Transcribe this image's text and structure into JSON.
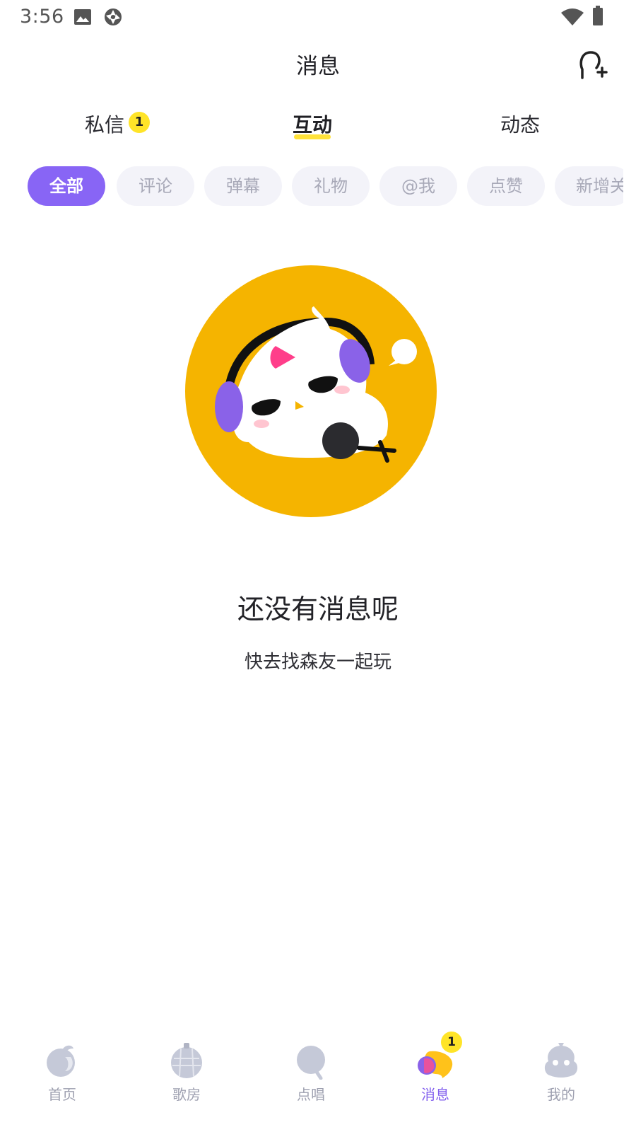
{
  "status_bar": {
    "time": "3:56",
    "icons": [
      "image-icon",
      "sync-icon",
      "wifi-icon",
      "battery-icon"
    ]
  },
  "header": {
    "title": "消息",
    "add_friend_icon": "add-friend-icon"
  },
  "main_tabs": [
    {
      "label": "私信",
      "badge": "1",
      "active": false
    },
    {
      "label": "互动",
      "active": true
    },
    {
      "label": "动态",
      "active": false
    }
  ],
  "filter_chips": [
    {
      "label": "全部",
      "active": true
    },
    {
      "label": "评论",
      "active": false
    },
    {
      "label": "弹幕",
      "active": false
    },
    {
      "label": "礼物",
      "active": false
    },
    {
      "label": "@我",
      "active": false
    },
    {
      "label": "点赞",
      "active": false
    },
    {
      "label": "新增关",
      "active": false
    }
  ],
  "empty_state": {
    "title": "还没有消息呢",
    "subtitle": "快去找森友一起玩"
  },
  "bottom_nav": [
    {
      "label": "首页",
      "icon": "home-icon",
      "active": false
    },
    {
      "label": "歌房",
      "icon": "disco-ball-icon",
      "active": false
    },
    {
      "label": "点唱",
      "icon": "microphone-icon",
      "active": false
    },
    {
      "label": "消息",
      "icon": "message-icon",
      "active": true,
      "badge": "1"
    },
    {
      "label": "我的",
      "icon": "profile-icon",
      "active": false
    }
  ],
  "colors": {
    "accent": "#8865f5",
    "badge": "#ffe428",
    "chip_bg": "#f3f3f9",
    "illustration_bg": "#f5b400"
  }
}
